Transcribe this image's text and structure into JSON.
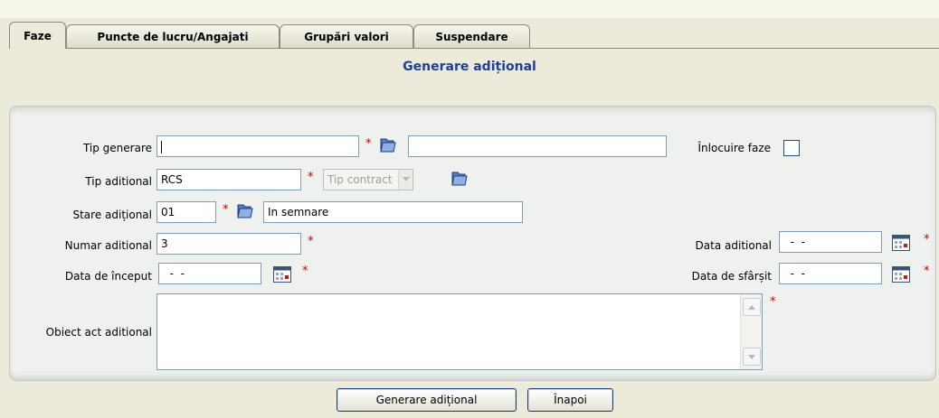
{
  "tabs": [
    {
      "label": "Faze",
      "active": true
    },
    {
      "label": "Puncte de lucru/Angajati",
      "active": false
    },
    {
      "label": "Grupări valori",
      "active": false
    },
    {
      "label": "Suspendare",
      "active": false
    }
  ],
  "page_title": "Generare adițional",
  "form": {
    "tip_generare": {
      "label": "Tip generare",
      "value": "",
      "desc_value": ""
    },
    "inlocuire_faze": {
      "label": "Înlocuire faze",
      "checked": false
    },
    "tip_aditional": {
      "label": "Tip aditional",
      "value": "RCS",
      "select_value": "Tip contract"
    },
    "stare_aditional": {
      "label": "Stare adițional",
      "value": "01",
      "desc_value": "In semnare"
    },
    "numar_aditional": {
      "label": "Numar aditional",
      "value": "3"
    },
    "data_aditional": {
      "label": "Data aditional",
      "value": "  -  -"
    },
    "data_inceput": {
      "label": "Data de început",
      "value": "  -  -"
    },
    "data_sfarsit": {
      "label": "Data de sfârșit",
      "value": "  -  -"
    },
    "obiect": {
      "label": "Obiect act aditional",
      "value": ""
    },
    "required_mark": "*"
  },
  "buttons": {
    "generare": "Generare adițional",
    "inapoi": "Înapoi"
  },
  "colors": {
    "title": "#1f3f9a",
    "required": "#d00000",
    "background": "#ecebdb"
  },
  "icons": {
    "lookup": "folder-icon",
    "date": "calendar-icon"
  }
}
